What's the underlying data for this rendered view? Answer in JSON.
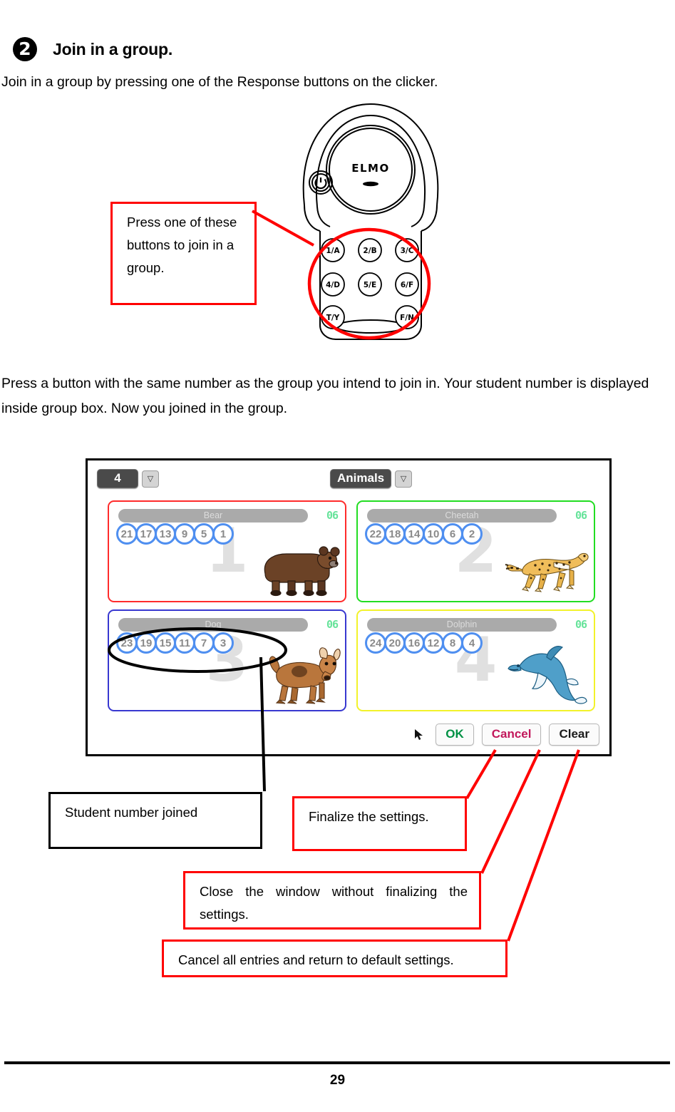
{
  "step": {
    "bullet": "2",
    "title": "Join in a group.",
    "intro": "Join in a group by pressing one of the Response buttons on the clicker.",
    "paragraph": "Press a button with the same number as the group you intend to join in. Your student number is displayed inside group box. Now you joined in the group."
  },
  "clicker": {
    "brand": "ELMO",
    "power_icon": "power-icon",
    "buttons": [
      "1/A",
      "2/B",
      "3/C",
      "4/D",
      "5/E",
      "6/F",
      "T/Y",
      "F/N"
    ]
  },
  "callouts": {
    "press_buttons": "Press one of these buttons to join in a group.",
    "student_number": "Student number joined",
    "finalize": "Finalize the settings.",
    "close_window": "Close the window without finalizing the settings.",
    "clear_all": "Cancel all entries and return to default settings."
  },
  "app": {
    "group_select": {
      "value": "4",
      "arrow_icon": "chevron-down-icon"
    },
    "set_select": {
      "value": "Animals",
      "arrow_icon": "chevron-down-icon"
    },
    "cursor_icon": "mouse-pointer-icon",
    "buttons": [
      {
        "label": "OK",
        "color": "#009144"
      },
      {
        "label": "Cancel",
        "color": "#c2185b"
      },
      {
        "label": "Clear",
        "color": "#1b1b1b"
      }
    ],
    "groups": [
      {
        "ghost": "1",
        "name": "Bear",
        "count": "06",
        "border_color": "#ff2b2b",
        "art": "bear-illustration",
        "chips": [
          "21",
          "17",
          "13",
          "9",
          "5",
          "1"
        ]
      },
      {
        "ghost": "2",
        "name": "Cheetah",
        "count": "06",
        "border_color": "#22dd22",
        "art": "cheetah-illustration",
        "chips": [
          "22",
          "18",
          "14",
          "10",
          "6",
          "2"
        ]
      },
      {
        "ghost": "3",
        "name": "Dog",
        "count": "06",
        "border_color": "#3838d0",
        "art": "dog-illustration",
        "chips": [
          "23",
          "19",
          "15",
          "11",
          "7",
          "3"
        ]
      },
      {
        "ghost": "4",
        "name": "Dolphin",
        "count": "06",
        "border_color": "#f2f22a",
        "art": "dolphin-illustration",
        "chips": [
          "24",
          "20",
          "16",
          "12",
          "8",
          "4"
        ]
      }
    ]
  },
  "footer": {
    "page_number": "29"
  }
}
